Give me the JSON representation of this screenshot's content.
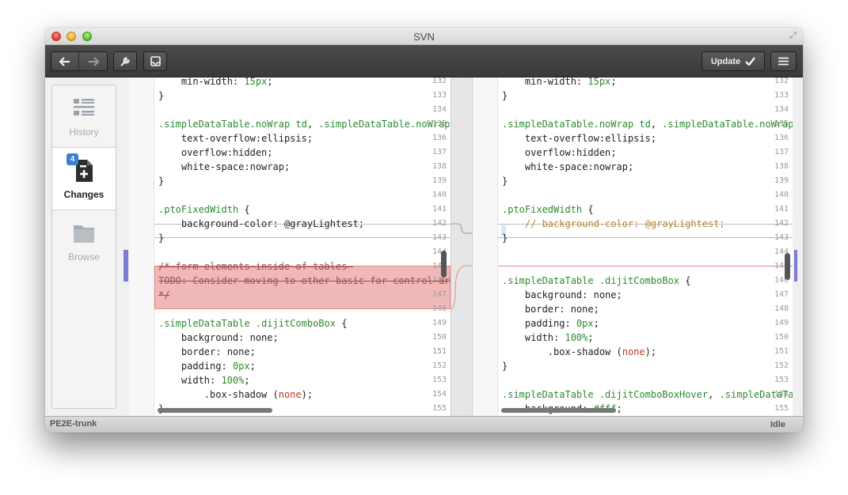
{
  "window": {
    "title": "SVN"
  },
  "toolbar": {
    "back_icon": "arrow-left-icon",
    "forward_icon": "arrow-right-icon",
    "wrench_icon": "wrench-icon",
    "inbox_icon": "inbox-icon",
    "update_label": "Update",
    "update_icon": "checkmark-icon",
    "menu_icon": "hamburger-menu-icon"
  },
  "sidebar": {
    "items": [
      {
        "label": "History",
        "icon": "history-list-icon"
      },
      {
        "label": "Changes",
        "icon": "changes-document-icon",
        "badge": "4"
      },
      {
        "label": "Browse",
        "icon": "folder-icon"
      }
    ]
  },
  "left_pane": {
    "lines": [
      {
        "no": "132",
        "code": [
          [
            "prop",
            "    min-width"
          ],
          [
            "brace",
            ": "
          ],
          [
            "val",
            "15px"
          ],
          [
            "brace",
            ";"
          ]
        ]
      },
      {
        "no": "133",
        "code": [
          [
            "brace",
            "}"
          ]
        ]
      },
      {
        "no": "134",
        "code": []
      },
      {
        "no": "135",
        "code": [
          [
            "sel",
            ".simpleDataTable.noWrap td"
          ],
          [
            "brace",
            ", "
          ],
          [
            "sel",
            ".simpleDataTable.noWrap t"
          ]
        ]
      },
      {
        "no": "136",
        "code": [
          [
            "prop",
            "    text-overflow"
          ],
          [
            "brace",
            ":"
          ],
          [
            "prop",
            "ellipsis"
          ],
          [
            "brace",
            ";"
          ]
        ]
      },
      {
        "no": "137",
        "code": [
          [
            "prop",
            "    overflow"
          ],
          [
            "brace",
            ":"
          ],
          [
            "prop",
            "hidden"
          ],
          [
            "brace",
            ";"
          ]
        ]
      },
      {
        "no": "138",
        "code": [
          [
            "prop",
            "    white-space"
          ],
          [
            "brace",
            ":"
          ],
          [
            "prop",
            "nowrap"
          ],
          [
            "brace",
            ";"
          ]
        ]
      },
      {
        "no": "139",
        "code": [
          [
            "brace",
            "}"
          ]
        ]
      },
      {
        "no": "140",
        "code": []
      },
      {
        "no": "141",
        "code": [
          [
            "sel",
            ".ptoFixedWidth"
          ],
          [
            "brace",
            " {"
          ]
        ]
      },
      {
        "no": "142",
        "code": [
          [
            "prop",
            "    background-color"
          ],
          [
            "brace",
            ": "
          ],
          [
            "prop",
            "@grayLightest"
          ],
          [
            "brace",
            ";"
          ]
        ]
      },
      {
        "no": "143",
        "code": [
          [
            "brace",
            "}"
          ]
        ]
      },
      {
        "no": "144",
        "code": []
      },
      {
        "no": "145",
        "code": [
          [
            "strike",
            "/* form elements inside of tables "
          ]
        ]
      },
      {
        "no": "146",
        "code": [
          [
            "strike",
            "TODO: Consider moving to other basic for control area"
          ]
        ]
      },
      {
        "no": "147",
        "code": [
          [
            "strike",
            "*/"
          ]
        ]
      },
      {
        "no": "148",
        "code": []
      },
      {
        "no": "149",
        "code": [
          [
            "sel",
            ".simpleDataTable .dijitComboBox"
          ],
          [
            "brace",
            " {"
          ]
        ]
      },
      {
        "no": "150",
        "code": [
          [
            "prop",
            "    background"
          ],
          [
            "brace",
            ": "
          ],
          [
            "prop",
            "none"
          ],
          [
            "brace",
            ";"
          ]
        ]
      },
      {
        "no": "151",
        "code": [
          [
            "prop",
            "    border"
          ],
          [
            "brace",
            ": "
          ],
          [
            "prop",
            "none"
          ],
          [
            "brace",
            ";"
          ]
        ]
      },
      {
        "no": "152",
        "code": [
          [
            "prop",
            "    padding"
          ],
          [
            "brace",
            ": "
          ],
          [
            "val",
            "0px"
          ],
          [
            "brace",
            ";"
          ]
        ]
      },
      {
        "no": "153",
        "code": [
          [
            "prop",
            "    width"
          ],
          [
            "brace",
            ": "
          ],
          [
            "val",
            "100%"
          ],
          [
            "brace",
            ";"
          ]
        ]
      },
      {
        "no": "154",
        "code": [
          [
            "prop",
            "        .box-shadow "
          ],
          [
            "brace",
            "("
          ],
          [
            "red",
            "none"
          ],
          [
            "brace",
            ");"
          ]
        ]
      },
      {
        "no": "155",
        "code": [
          [
            "brace",
            "}"
          ]
        ]
      }
    ]
  },
  "right_pane": {
    "lines": [
      {
        "no": "132",
        "code": [
          [
            "prop",
            "    min-width"
          ],
          [
            "brace",
            ": "
          ],
          [
            "val",
            "15px"
          ],
          [
            "brace",
            ";"
          ]
        ]
      },
      {
        "no": "133",
        "code": [
          [
            "brace",
            "}"
          ]
        ]
      },
      {
        "no": "134",
        "code": []
      },
      {
        "no": "135",
        "code": [
          [
            "sel",
            ".simpleDataTable.noWrap td"
          ],
          [
            "brace",
            ", "
          ],
          [
            "sel",
            ".simpleDataTable.noWrap t"
          ]
        ]
      },
      {
        "no": "136",
        "code": [
          [
            "prop",
            "    text-overflow"
          ],
          [
            "brace",
            ":"
          ],
          [
            "prop",
            "ellipsis"
          ],
          [
            "brace",
            ";"
          ]
        ]
      },
      {
        "no": "137",
        "code": [
          [
            "prop",
            "    overflow"
          ],
          [
            "brace",
            ":"
          ],
          [
            "prop",
            "hidden"
          ],
          [
            "brace",
            ";"
          ]
        ]
      },
      {
        "no": "138",
        "code": [
          [
            "prop",
            "    white-space"
          ],
          [
            "brace",
            ":"
          ],
          [
            "prop",
            "nowrap"
          ],
          [
            "brace",
            ";"
          ]
        ]
      },
      {
        "no": "139",
        "code": [
          [
            "brace",
            "}"
          ]
        ]
      },
      {
        "no": "140",
        "code": []
      },
      {
        "no": "141",
        "code": [
          [
            "sel",
            ".ptoFixedWidth"
          ],
          [
            "brace",
            " {"
          ]
        ]
      },
      {
        "no": "142",
        "code": [
          [
            "comment",
            "    // background-color: @grayLightest;"
          ]
        ]
      },
      {
        "no": "143",
        "code": [
          [
            "brace",
            "}"
          ]
        ]
      },
      {
        "no": "144",
        "code": []
      },
      {
        "no": "145",
        "code": []
      },
      {
        "no": "146",
        "code": [
          [
            "sel",
            ".simpleDataTable .dijitComboBox"
          ],
          [
            "brace",
            " {"
          ]
        ]
      },
      {
        "no": "147",
        "code": [
          [
            "prop",
            "    background"
          ],
          [
            "brace",
            ": "
          ],
          [
            "prop",
            "none"
          ],
          [
            "brace",
            ";"
          ]
        ]
      },
      {
        "no": "148",
        "code": [
          [
            "prop",
            "    border"
          ],
          [
            "brace",
            ": "
          ],
          [
            "prop",
            "none"
          ],
          [
            "brace",
            ";"
          ]
        ]
      },
      {
        "no": "149",
        "code": [
          [
            "prop",
            "    padding"
          ],
          [
            "brace",
            ": "
          ],
          [
            "val",
            "0px"
          ],
          [
            "brace",
            ";"
          ]
        ]
      },
      {
        "no": "150",
        "code": [
          [
            "prop",
            "    width"
          ],
          [
            "brace",
            ": "
          ],
          [
            "val",
            "100%"
          ],
          [
            "brace",
            ";"
          ]
        ]
      },
      {
        "no": "151",
        "code": [
          [
            "prop",
            "        .box-shadow "
          ],
          [
            "brace",
            "("
          ],
          [
            "red",
            "none"
          ],
          [
            "brace",
            ");"
          ]
        ]
      },
      {
        "no": "152",
        "code": [
          [
            "brace",
            "}"
          ]
        ]
      },
      {
        "no": "153",
        "code": []
      },
      {
        "no": "154",
        "code": [
          [
            "sel",
            ".simpleDataTable .dijitComboBoxHover"
          ],
          [
            "brace",
            ", "
          ],
          [
            "sel",
            ".simpleDataTabl"
          ]
        ]
      },
      {
        "no": "155",
        "code": [
          [
            "prop",
            "    background"
          ],
          [
            "brace",
            ": "
          ],
          [
            "val",
            "#fff"
          ],
          [
            "brace",
            ";"
          ]
        ]
      }
    ]
  },
  "statusbar": {
    "repo": "PE2E-trunk",
    "state": "Idle"
  }
}
